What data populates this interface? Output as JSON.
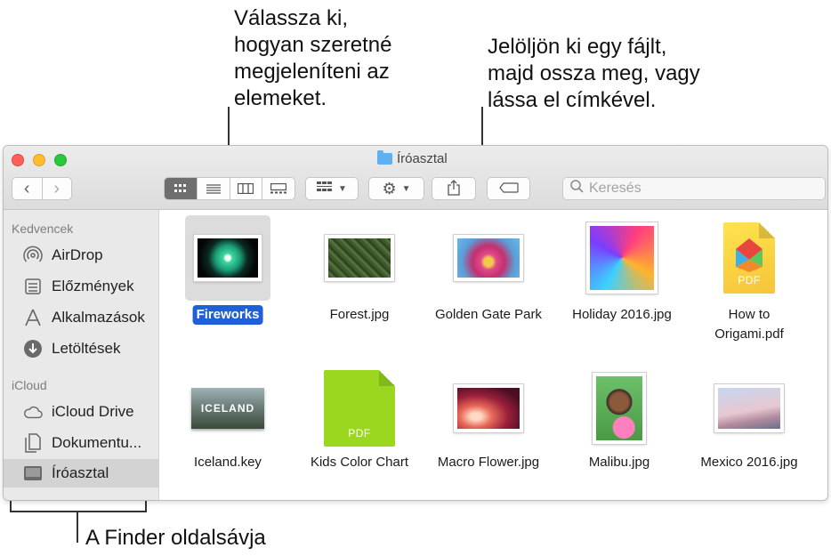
{
  "callouts": {
    "view": "Válassza ki,\nhogyan szeretné\nmegjeleníteni az\nelemeket.",
    "share": "Jelöljön ki egy fájlt,\nmajd ossza meg, vagy\nlássa el címkével.",
    "sidebar": "A Finder oldalsávja"
  },
  "window": {
    "title": "Íróasztal"
  },
  "toolbar": {
    "back_icon": "chevron-left-icon",
    "forward_icon": "chevron-right-icon",
    "view_icons": [
      "icon-view-icon",
      "list-view-icon",
      "column-view-icon",
      "gallery-view-icon"
    ],
    "group_icon": "group-icon",
    "action_icon": "gear-icon",
    "share_icon": "share-icon",
    "tag_icon": "tag-icon"
  },
  "search": {
    "placeholder": "Keresés"
  },
  "sidebar": {
    "sections": [
      {
        "label": "Kedvencek"
      },
      {
        "label": "iCloud"
      }
    ],
    "items": [
      {
        "label": "AirDrop",
        "icon": "airdrop-icon"
      },
      {
        "label": "Előzmények",
        "icon": "recents-icon"
      },
      {
        "label": "Alkalmazások",
        "icon": "applications-icon"
      },
      {
        "label": "Letöltések",
        "icon": "downloads-icon"
      },
      {
        "label": "iCloud Drive",
        "icon": "cloud-icon"
      },
      {
        "label": "Dokumentu...",
        "icon": "documents-icon"
      },
      {
        "label": "Íróasztal",
        "icon": "desktop-icon"
      }
    ]
  },
  "files": [
    {
      "name": "Fireworks",
      "kind": "image",
      "selected": true
    },
    {
      "name": "Forest.jpg",
      "kind": "image"
    },
    {
      "name": "Golden Gate Park",
      "kind": "image"
    },
    {
      "name": "Holiday 2016.jpg",
      "kind": "image"
    },
    {
      "name": "How to\nOrigami.pdf",
      "kind": "pdf",
      "badge": "PDF"
    },
    {
      "name": "Iceland.key",
      "kind": "keynote",
      "thumb_text": "ICELAND"
    },
    {
      "name": "Kids Color Chart",
      "kind": "pdf",
      "badge": "PDF"
    },
    {
      "name": "Macro Flower.jpg",
      "kind": "image"
    },
    {
      "name": "Malibu.jpg",
      "kind": "image"
    },
    {
      "name": "Mexico 2016.jpg",
      "kind": "image"
    }
  ],
  "colors": {
    "selection": "#1f5fd7",
    "close": "#fe5f57",
    "minimize": "#febc2e",
    "maximize": "#28c840",
    "folder": "#5fb0f0"
  }
}
